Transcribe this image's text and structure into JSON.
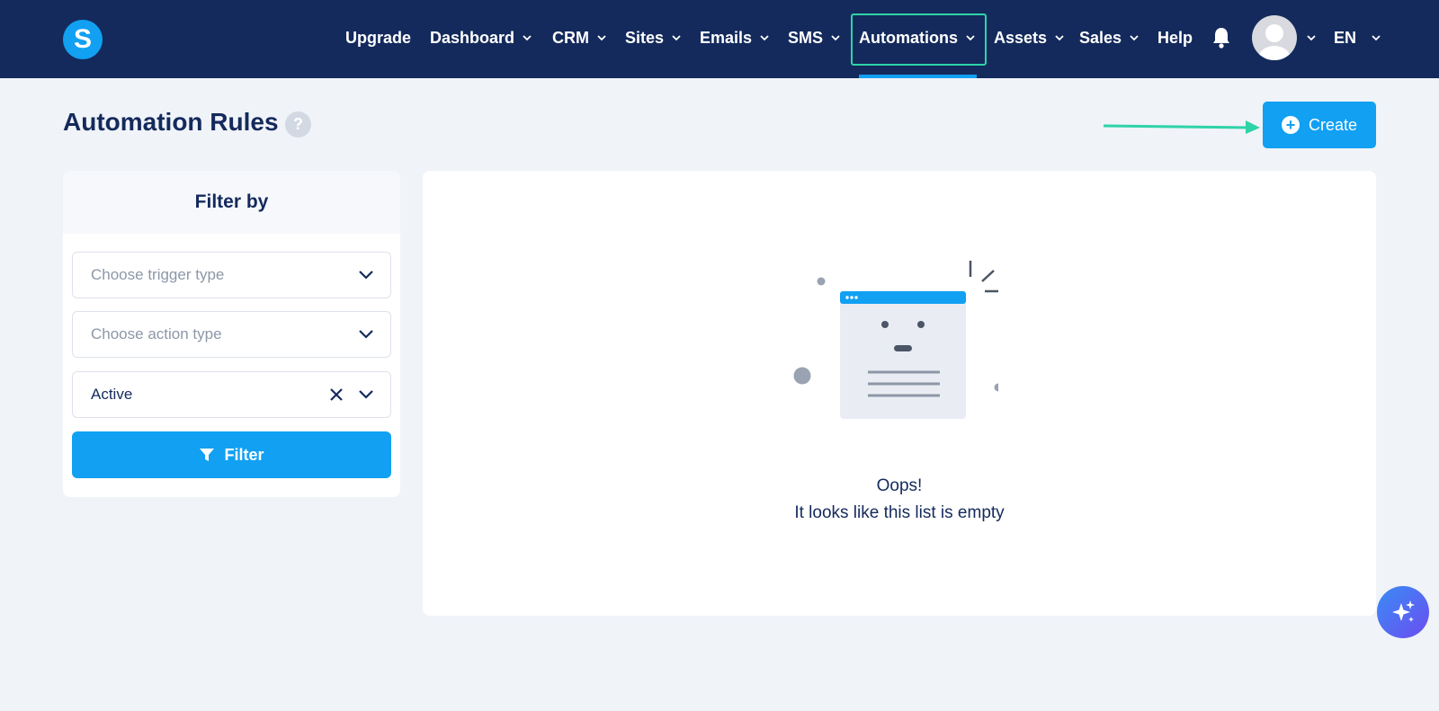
{
  "app": {
    "logo_letter": "S"
  },
  "nav": {
    "items": [
      {
        "label": "Upgrade",
        "dropdown": false
      },
      {
        "label": "Dashboard",
        "dropdown": true
      },
      {
        "label": "CRM",
        "dropdown": true
      },
      {
        "label": "Sites",
        "dropdown": true
      },
      {
        "label": "Emails",
        "dropdown": true
      },
      {
        "label": "SMS",
        "dropdown": true
      },
      {
        "label": "Automations",
        "dropdown": true,
        "active": true
      },
      {
        "label": "Assets",
        "dropdown": true
      },
      {
        "label": "Sales",
        "dropdown": true
      },
      {
        "label": "Help",
        "dropdown": false
      }
    ],
    "bell_icon": "bell-icon",
    "avatar_icon": "user-avatar",
    "language": "EN"
  },
  "header": {
    "title": "Automation Rules",
    "help_symbol": "?",
    "create_label": "Create",
    "create_icon": "plus-circle-icon"
  },
  "filter": {
    "title": "Filter by",
    "trigger_placeholder": "Choose trigger type",
    "action_placeholder": "Choose action type",
    "status_value": "Active",
    "filter_button_label": "Filter",
    "filter_icon": "funnel-icon"
  },
  "empty_state": {
    "line1": "Oops!",
    "line2": "It looks like this list is empty"
  },
  "colors": {
    "navbar": "#142a5c",
    "accent": "#11a0f2",
    "highlight": "#2ed3a8",
    "background": "#f0f3f8"
  }
}
